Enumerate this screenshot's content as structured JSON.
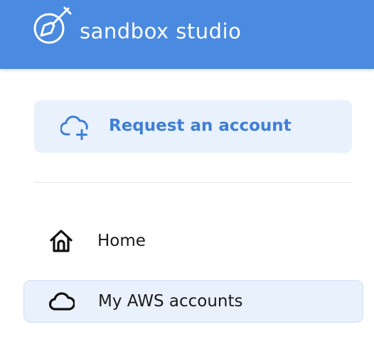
{
  "app": {
    "name": "sandbox studio",
    "logo_icon": "shovel-circle-icon"
  },
  "request_account": {
    "label": "Request an account",
    "icon": "cloud-plus-icon"
  },
  "nav": {
    "items": [
      {
        "label": "Home",
        "icon": "home-icon",
        "active": false
      },
      {
        "label": "My AWS accounts",
        "icon": "cloud-icon",
        "active": true
      }
    ]
  },
  "colors": {
    "header_bg": "#4a8ae0",
    "accent": "#3f7fd6",
    "active_bg": "#e8f1fc"
  }
}
